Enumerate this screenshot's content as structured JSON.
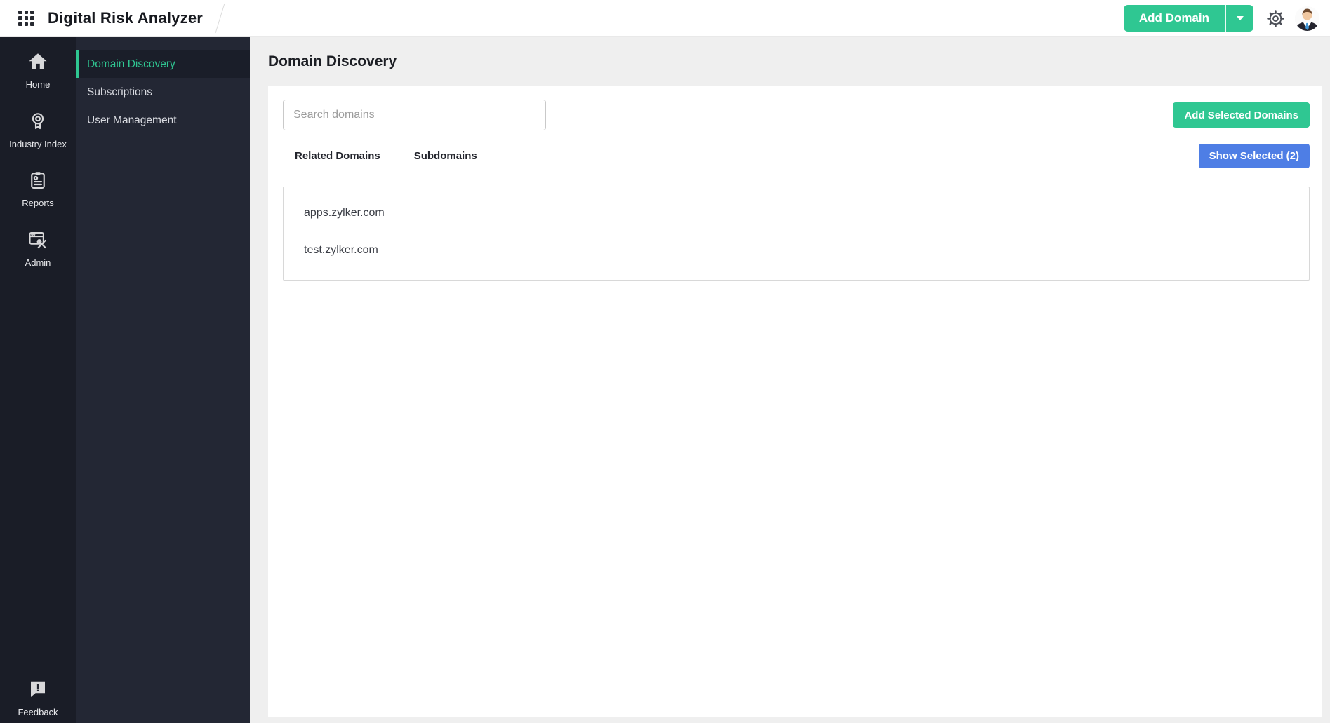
{
  "colors": {
    "accent_green": "#2fc792",
    "accent_blue": "#4e7ee5",
    "sidebar_primary_bg": "#1a1d27",
    "sidebar_secondary_bg": "#232734"
  },
  "header": {
    "app_title": "Digital Risk Analyzer",
    "add_domain_label": "Add Domain",
    "icons": {
      "app_launcher": "app-launcher-grid",
      "caret": "caret-down",
      "settings": "gear",
      "avatar": "user-avatar"
    }
  },
  "primary_sidebar": {
    "items": [
      {
        "label": "Home",
        "icon": "home-icon"
      },
      {
        "label": "Industry Index",
        "icon": "industry-index-icon"
      },
      {
        "label": "Reports",
        "icon": "reports-icon"
      },
      {
        "label": "Admin",
        "icon": "admin-icon"
      }
    ],
    "feedback": {
      "label": "Feedback",
      "icon": "feedback-icon"
    }
  },
  "secondary_sidebar": {
    "items": [
      {
        "label": "Domain Discovery",
        "active": true
      },
      {
        "label": "Subscriptions",
        "active": false
      },
      {
        "label": "User Management",
        "active": false
      }
    ]
  },
  "main": {
    "page_title": "Domain Discovery",
    "search": {
      "placeholder": "Search domains",
      "value": ""
    },
    "buttons": {
      "add_selected": "Add Selected Domains",
      "show_selected": "Show Selected (2)"
    },
    "tabs": [
      {
        "label": "Related Domains",
        "active": true
      },
      {
        "label": "Subdomains",
        "active": false
      }
    ],
    "domains": [
      "apps.zylker.com",
      "test.zylker.com"
    ]
  }
}
